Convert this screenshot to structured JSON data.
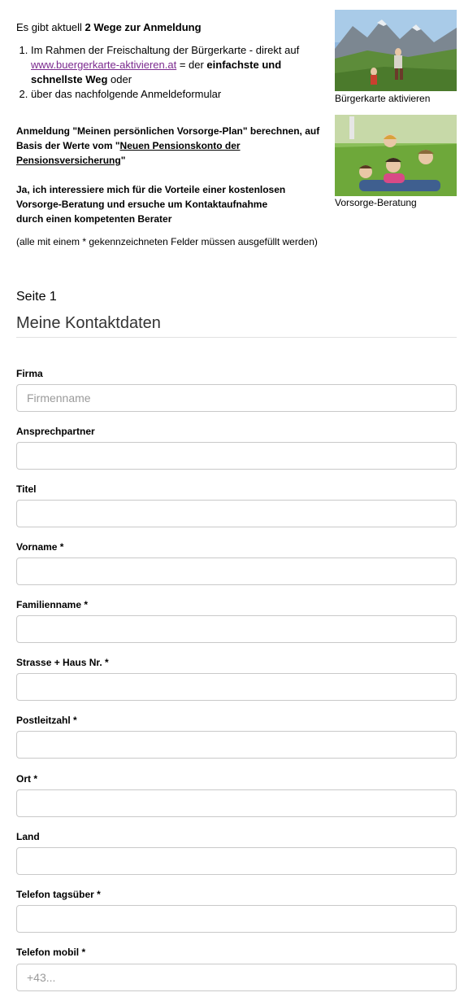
{
  "intro": {
    "lead_prefix": "Es gibt aktuell ",
    "lead_bold": "2 Wege zur Anmeldung",
    "item1_text": "Im Rahmen der Freischaltung der Bürgerkarte - direkt auf ",
    "item1_link": "www.buergerkarte-aktivieren.at",
    "item1_mid": " = der ",
    "item1_bold": "einfachste und schnellste Weg",
    "item1_suffix": " oder",
    "item2_text": "über das nachfolgende Anmeldeformular"
  },
  "bold_block": {
    "p1_prefix": "Anmeldung \"Meinen persönlichen Vorsorge-Plan\" berechnen, auf Basis der Werte vom \"",
    "p1_link": "Neuen Pensionskonto der Pensionsversicherung",
    "p1_suffix": "\"",
    "p2_line1": "Ja, ich interessiere mich für die Vorteile einer kostenlosen",
    "p2_line2": "Vorsorge-Beratung und ersuche um Kontaktaufnahme",
    "p2_line3": "durch einen kompetenten Berater"
  },
  "note": "(alle mit einem * gekennzeichneten Felder müssen ausgefüllt werden)",
  "images": {
    "caption1": "Bürgerkarte aktivieren",
    "caption2": "Vorsorge-Beratung"
  },
  "section": {
    "page": "Seite 1",
    "title": "Meine Kontaktdaten"
  },
  "fields": [
    {
      "label": "Firma",
      "placeholder": "Firmenname",
      "value": ""
    },
    {
      "label": "Ansprechpartner",
      "placeholder": "",
      "value": ""
    },
    {
      "label": "Titel",
      "placeholder": "",
      "value": ""
    },
    {
      "label": "Vorname *",
      "placeholder": "",
      "value": ""
    },
    {
      "label": "Familienname *",
      "placeholder": "",
      "value": ""
    },
    {
      "label": "Strasse + Haus Nr. *",
      "placeholder": "",
      "value": ""
    },
    {
      "label": "Postleitzahl *",
      "placeholder": "",
      "value": ""
    },
    {
      "label": "Ort *",
      "placeholder": "",
      "value": ""
    },
    {
      "label": "Land",
      "placeholder": "",
      "value": ""
    },
    {
      "label": "Telefon tagsüber *",
      "placeholder": "",
      "value": ""
    },
    {
      "label": "Telefon mobil *",
      "placeholder": "+43...",
      "value": ""
    }
  ]
}
